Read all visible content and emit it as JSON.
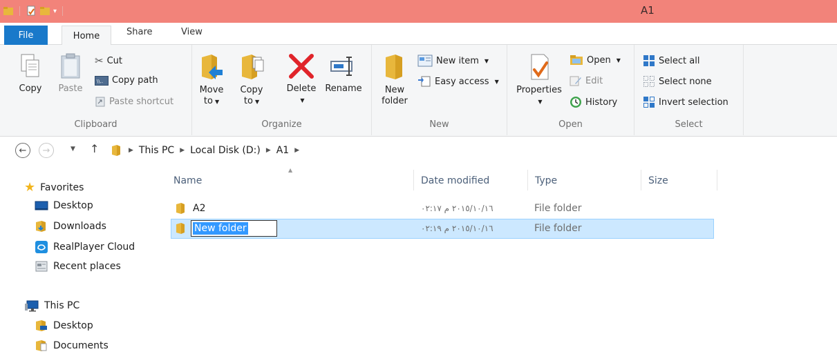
{
  "window": {
    "title": "A1"
  },
  "tabs": {
    "file": "File",
    "home": "Home",
    "share": "Share",
    "view": "View"
  },
  "ribbon": {
    "clipboard": {
      "label": "Clipboard",
      "copy": "Copy",
      "paste": "Paste",
      "cut": "Cut",
      "copy_path": "Copy path",
      "paste_shortcut": "Paste shortcut"
    },
    "organize": {
      "label": "Organize",
      "move_to_1": "Move",
      "move_to_2": "to",
      "copy_to_1": "Copy",
      "copy_to_2": "to",
      "delete": "Delete",
      "rename": "Rename"
    },
    "new": {
      "label": "New",
      "new_folder_1": "New",
      "new_folder_2": "folder",
      "new_item": "New item",
      "easy_access": "Easy access"
    },
    "open": {
      "label": "Open",
      "properties": "Properties",
      "open": "Open",
      "edit": "Edit",
      "history": "History"
    },
    "select": {
      "label": "Select",
      "select_all": "Select all",
      "select_none": "Select none",
      "invert_selection": "Invert selection"
    }
  },
  "address": {
    "crumbs": [
      "This PC",
      "Local Disk (D:)",
      "A1"
    ]
  },
  "nav": {
    "favorites": "Favorites",
    "desktop": "Desktop",
    "downloads": "Downloads",
    "realplayer": "RealPlayer Cloud",
    "recent": "Recent places",
    "this_pc": "This PC",
    "pc_desktop": "Desktop",
    "pc_documents": "Documents"
  },
  "columns": {
    "name": "Name",
    "date": "Date modified",
    "type": "Type",
    "size": "Size"
  },
  "files": [
    {
      "name": "A2",
      "date": "٢٠١٥/١٠/١٦ م ٠٢:١٧",
      "type": "File folder"
    },
    {
      "name": "New folder",
      "date": "٢٠١٥/١٠/١٦ م ٠٢:١٩",
      "type": "File folder"
    }
  ],
  "colors": {
    "titlebar": "#f2837a",
    "file_tab": "#1979ca",
    "selection": "#cce8ff"
  }
}
